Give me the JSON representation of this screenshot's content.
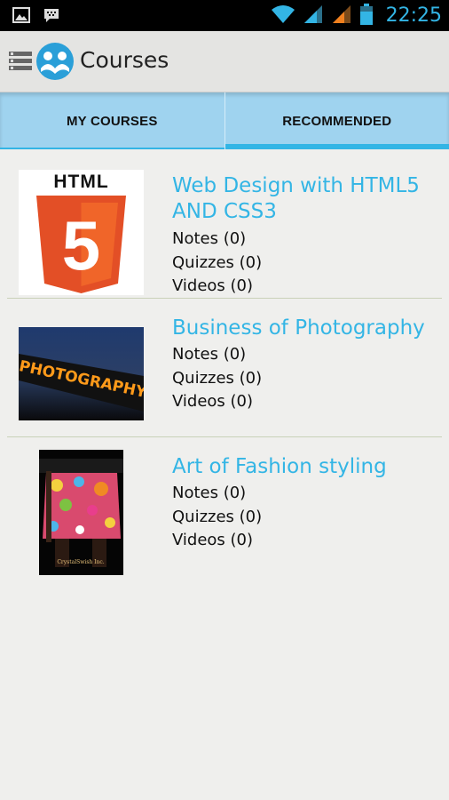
{
  "status_bar": {
    "time": "22:25",
    "icons": [
      "gallery-icon",
      "bbm-icon",
      "wifi-icon",
      "signal-icon",
      "signal-icon",
      "battery-icon"
    ]
  },
  "action_bar": {
    "title": "Courses",
    "icons": [
      "drawer-menu-icon",
      "app-logo-icon"
    ]
  },
  "tabs": [
    {
      "label": "MY COURSES"
    },
    {
      "label": "RECOMMENDED",
      "selected": true
    }
  ],
  "courses": [
    {
      "title": "Web Design with HTML5 AND CSS3",
      "notes": "Notes (0)",
      "quizzes": "Quizzes (0)",
      "videos": "Videos (0)",
      "thumbnail_text": "HTML",
      "thumbnail_numeral": "5"
    },
    {
      "title": "Business of Photography",
      "notes": "Notes (0)",
      "quizzes": "Quizzes (0)",
      "videos": "Videos (0)",
      "thumbnail_text": "PHOTOGRAPHY"
    },
    {
      "title": "Art of Fashion styling",
      "notes": "Notes (0)",
      "quizzes": "Quizzes (0)",
      "videos": "Videos (0)",
      "thumbnail_text": "CrystalSwish Inc."
    }
  ],
  "colors": {
    "accent": "#33b5e5",
    "tab_bg": "#9fd3ef",
    "background": "#efefed"
  }
}
